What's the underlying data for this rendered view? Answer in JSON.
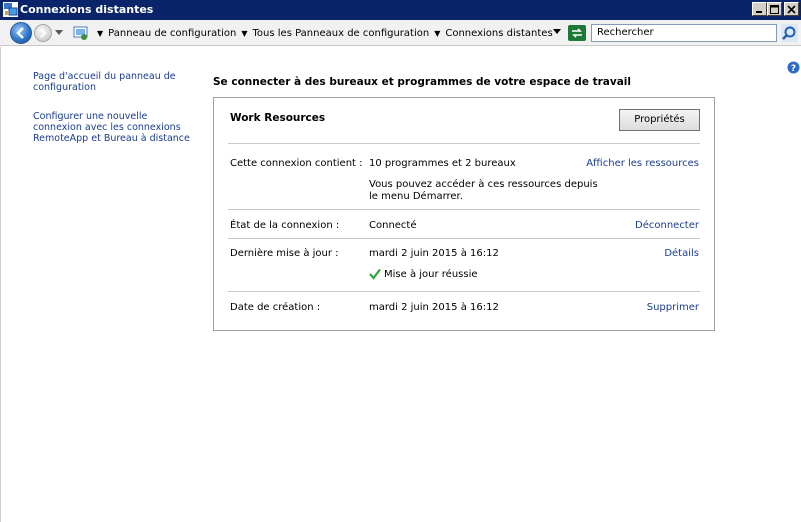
{
  "window": {
    "title": "Connexions distantes"
  },
  "navbar": {
    "breadcrumbs": [
      "Panneau de configuration",
      "Tous les Panneaux de configuration",
      "Connexions distantes"
    ],
    "search_placeholder": "Rechercher"
  },
  "left_pane": {
    "links": [
      "Page d'accueil du panneau de configuration",
      "Configurer une nouvelle connexion avec les connexions RemoteApp et Bureau à distance"
    ]
  },
  "main": {
    "heading": "Se connecter à des bureaux et programmes de votre espace de travail",
    "panel": {
      "title": "Work Resources",
      "properties_button": "Propriétés",
      "rows": [
        {
          "label": "Cette connexion contient :",
          "value": "10 programmes et 2 bureaux",
          "note": "Vous pouvez accéder à ces ressources depuis le menu Démarrer.",
          "action": "Afficher les ressources"
        },
        {
          "label": "État de la connexion :",
          "value": "Connecté",
          "action": "Déconnecter"
        },
        {
          "label": "Dernière mise à jour :",
          "value": "mardi 2 juin 2015 à 16:12",
          "status": "Mise à jour réussie",
          "action": "Détails"
        },
        {
          "label": "Date de création :",
          "value": "mardi 2 juin 2015 à 16:12",
          "action": "Supprimer"
        }
      ]
    }
  },
  "icons": {
    "app": "remote-connections-icon",
    "back": "back-arrow-icon",
    "forward": "forward-arrow-icon",
    "refresh": "refresh-icon",
    "search": "search-icon",
    "help": "help-icon",
    "success": "checkmark-icon"
  },
  "colors": {
    "titlebar": "#0a246a",
    "link": "#1a3d91",
    "success": "#2fa33a"
  }
}
